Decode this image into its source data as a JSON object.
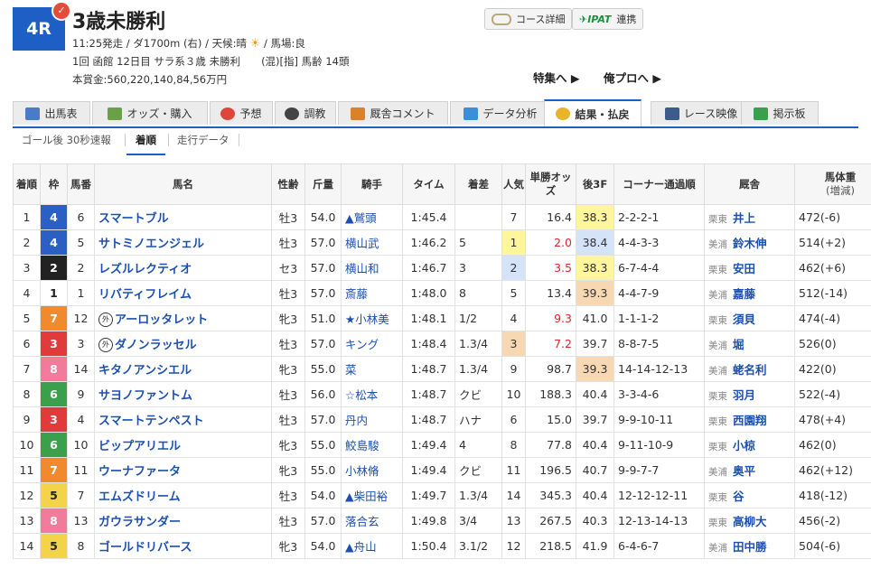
{
  "race": {
    "number": "4R",
    "title": "3歳未勝利",
    "line1": "11:25発走 / ダ1700m (右) / 天候:晴",
    "line1_b": "/ 馬場:良",
    "line2": "1回 函館 12日目 サラ系３歳 未勝利　　(混)[指] 馬齢 14頭",
    "line3": "本賞金:560,220,140,84,56万円"
  },
  "buttons": {
    "course": "コース詳細",
    "ipat": "連携"
  },
  "links": {
    "feature": "特集へ ▶",
    "pro": "俺プロへ ▶"
  },
  "tabs": [
    "出馬表",
    "オッズ・購入",
    "予想",
    "調教",
    "厩舎コメント",
    "データ分析",
    "結果・払戻",
    "レース映像",
    "掲示板"
  ],
  "subtabs": [
    "ゴール後 30秒速報",
    "着順",
    "走行データ"
  ],
  "headers": {
    "rank": "着順",
    "waku": "枠",
    "num": "馬番",
    "name": "馬名",
    "sexage": "性齢",
    "weight": "斤量",
    "jockey": "騎手",
    "time": "タイム",
    "margin": "着差",
    "pop": "人気",
    "odds": "単勝オッズ",
    "last3f": "後3F",
    "corner": "コーナー通過順",
    "stable": "厩舎",
    "body": "馬体重",
    "body_sub": "(増減)"
  },
  "colors": {
    "waku": {
      "1": "#ffffff",
      "2": "#222222",
      "3": "#e03a3a",
      "4": "#2a5fc4",
      "5": "#f2d34a",
      "6": "#3aa04c",
      "7": "#f08a2c",
      "8": "#f27a9a"
    }
  },
  "rows": [
    {
      "rank": "1",
      "waku": "4",
      "num": "6",
      "mark": "",
      "name": "スマートブル",
      "sexage": "牡3",
      "weight": "54.0",
      "jockey": "▲鷲頭",
      "time": "1:45.4",
      "margin": "",
      "pop": "7",
      "odds": "16.4",
      "l3f": "38.3",
      "corner": "2-2-2-1",
      "region": "栗東",
      "trainer": "井上",
      "body": "472(-6)"
    },
    {
      "rank": "2",
      "waku": "4",
      "num": "5",
      "mark": "",
      "name": "サトミノエンジェル",
      "sexage": "牡3",
      "weight": "57.0",
      "jockey": "横山武",
      "time": "1:46.2",
      "margin": "5",
      "pop": "1",
      "odds": "2.0",
      "l3f": "38.4",
      "corner": "4-4-3-3",
      "region": "美浦",
      "trainer": "鈴木伸",
      "body": "514(+2)"
    },
    {
      "rank": "3",
      "waku": "2",
      "num": "2",
      "mark": "",
      "name": "レズルレクティオ",
      "sexage": "セ3",
      "weight": "57.0",
      "jockey": "横山和",
      "time": "1:46.7",
      "margin": "3",
      "pop": "2",
      "odds": "3.5",
      "l3f": "38.3",
      "corner": "6-7-4-4",
      "region": "栗東",
      "trainer": "安田",
      "body": "462(+6)"
    },
    {
      "rank": "4",
      "waku": "1",
      "num": "1",
      "mark": "",
      "name": "リバティフレイム",
      "sexage": "牡3",
      "weight": "57.0",
      "jockey": "斎藤",
      "time": "1:48.0",
      "margin": "8",
      "pop": "5",
      "odds": "13.4",
      "l3f": "39.3",
      "corner": "4-4-7-9",
      "region": "美浦",
      "trainer": "嘉藤",
      "body": "512(-14)"
    },
    {
      "rank": "5",
      "waku": "7",
      "num": "12",
      "mark": "外",
      "name": "アーロッタレット",
      "sexage": "牝3",
      "weight": "51.0",
      "jockey": "★小林美",
      "time": "1:48.1",
      "margin": "1/2",
      "pop": "4",
      "odds": "9.3",
      "l3f": "41.0",
      "corner": "1-1-1-2",
      "region": "栗東",
      "trainer": "須貝",
      "body": "474(-4)"
    },
    {
      "rank": "6",
      "waku": "3",
      "num": "3",
      "mark": "外",
      "name": "ダノンラッセル",
      "sexage": "牡3",
      "weight": "57.0",
      "jockey": "キング",
      "time": "1:48.4",
      "margin": "1.3/4",
      "pop": "3",
      "odds": "7.2",
      "l3f": "39.7",
      "corner": "8-8-7-5",
      "region": "美浦",
      "trainer": "堀",
      "body": "526(0)"
    },
    {
      "rank": "7",
      "waku": "8",
      "num": "14",
      "mark": "",
      "name": "キタノアンシエル",
      "sexage": "牝3",
      "weight": "55.0",
      "jockey": "菜",
      "time": "1:48.7",
      "margin": "1.3/4",
      "pop": "9",
      "odds": "98.7",
      "l3f": "39.3",
      "corner": "14-14-12-13",
      "region": "美浦",
      "trainer": "蛯名利",
      "body": "422(0)"
    },
    {
      "rank": "8",
      "waku": "6",
      "num": "9",
      "mark": "",
      "name": "サヨノファントム",
      "sexage": "牡3",
      "weight": "56.0",
      "jockey": "☆松本",
      "time": "1:48.7",
      "margin": "クビ",
      "pop": "10",
      "odds": "188.3",
      "l3f": "40.4",
      "corner": "3-3-4-6",
      "region": "栗東",
      "trainer": "羽月",
      "body": "522(-4)"
    },
    {
      "rank": "9",
      "waku": "3",
      "num": "4",
      "mark": "",
      "name": "スマートテンペスト",
      "sexage": "牡3",
      "weight": "57.0",
      "jockey": "丹内",
      "time": "1:48.7",
      "margin": "ハナ",
      "pop": "6",
      "odds": "15.0",
      "l3f": "39.7",
      "corner": "9-9-10-11",
      "region": "栗東",
      "trainer": "西園翔",
      "body": "478(+4)"
    },
    {
      "rank": "10",
      "waku": "6",
      "num": "10",
      "mark": "",
      "name": "ビップアリエル",
      "sexage": "牝3",
      "weight": "55.0",
      "jockey": "鮫島駿",
      "time": "1:49.4",
      "margin": "4",
      "pop": "8",
      "odds": "77.8",
      "l3f": "40.4",
      "corner": "9-11-10-9",
      "region": "栗東",
      "trainer": "小椋",
      "body": "462(0)"
    },
    {
      "rank": "11",
      "waku": "7",
      "num": "11",
      "mark": "",
      "name": "ウーナファータ",
      "sexage": "牝3",
      "weight": "55.0",
      "jockey": "小林脩",
      "time": "1:49.4",
      "margin": "クビ",
      "pop": "11",
      "odds": "196.5",
      "l3f": "40.7",
      "corner": "9-9-7-7",
      "region": "美浦",
      "trainer": "奥平",
      "body": "462(+12)"
    },
    {
      "rank": "12",
      "waku": "5",
      "num": "7",
      "mark": "",
      "name": "エムズドリーム",
      "sexage": "牡3",
      "weight": "54.0",
      "jockey": "▲柴田裕",
      "time": "1:49.7",
      "margin": "1.3/4",
      "pop": "14",
      "odds": "345.3",
      "l3f": "40.4",
      "corner": "12-12-12-11",
      "region": "栗東",
      "trainer": "谷",
      "body": "418(-12)"
    },
    {
      "rank": "13",
      "waku": "8",
      "num": "13",
      "mark": "",
      "name": "ガウラサンダー",
      "sexage": "牡3",
      "weight": "57.0",
      "jockey": "落合玄",
      "time": "1:49.8",
      "margin": "3/4",
      "pop": "13",
      "odds": "267.5",
      "l3f": "40.3",
      "corner": "12-13-14-13",
      "region": "栗東",
      "trainer": "高柳大",
      "body": "456(-2)"
    },
    {
      "rank": "14",
      "waku": "5",
      "num": "8",
      "mark": "",
      "name": "ゴールドリバース",
      "sexage": "牝3",
      "weight": "54.0",
      "jockey": "▲舟山",
      "time": "1:50.4",
      "margin": "3.1/2",
      "pop": "12",
      "odds": "218.5",
      "l3f": "41.9",
      "corner": "6-4-6-7",
      "region": "美浦",
      "trainer": "田中勝",
      "body": "504(-6)"
    }
  ]
}
